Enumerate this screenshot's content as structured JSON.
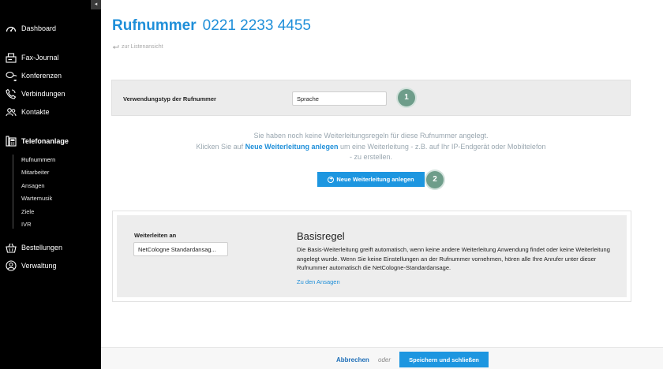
{
  "sidebar": {
    "collapse_glyph": "◂",
    "items": [
      {
        "label": "Dashboard",
        "icon": "dashboard-gauge-icon"
      },
      {
        "label": "Fax-Journal",
        "icon": "fax-icon"
      },
      {
        "label": "Konferenzen",
        "icon": "conference-chat-icon"
      },
      {
        "label": "Verbindungen",
        "icon": "phone-call-icon"
      },
      {
        "label": "Kontakte",
        "icon": "contacts-icon"
      },
      {
        "label": "Telefonanlage",
        "icon": "phone-system-icon"
      },
      {
        "label": "Bestellungen",
        "icon": "shopping-basket-icon"
      },
      {
        "label": "Verwaltung",
        "icon": "user-circle-icon"
      }
    ],
    "sub_items": [
      "Rufnummern",
      "Mitarbeiter",
      "Ansagen",
      "Wartemusik",
      "Ziele",
      "IVR"
    ]
  },
  "header": {
    "title_word": "Rufnummer",
    "title_number": "0221 2233 4455",
    "back_link": "zur Listenansicht"
  },
  "type_panel": {
    "label": "Verwendungstyp der Rufnummer",
    "selected": "Sprache",
    "step": "1"
  },
  "info": {
    "line1": "Sie haben noch keine Weiterleitungsregeln für diese Rufnummer angelegt.",
    "line2_pre": "Klicken Sie auf",
    "line2_link": "Neue Weiterleitung anlegen",
    "line2_post": "um eine Weiterleitung - z.B. auf Ihr IP-Endgerät oder Mobiltelefon",
    "line3": "- zu erstellen."
  },
  "new_button": {
    "label": "Neue Weiterleitung anlegen",
    "step": "2"
  },
  "rule": {
    "fwd_label": "Weiterleiten an",
    "fwd_selected": "NetCologne Standardansag...",
    "title": "Basisregel",
    "description": "Die Basis-Weiterleitung greift automatisch, wenn keine andere Weiterleitung Anwendung findet oder keine Weiterleitung angelegt wurde. Wenn Sie keine Einstellungen an der Rufnummer vornehmen, hören alle Ihre Anrufer unter dieser Rufnummer automatisch die NetCologne-Standardansage.",
    "link": "Zu den Ansagen"
  },
  "footer": {
    "cancel": "Abbrechen",
    "or": "oder",
    "save": "Speichern und schließen"
  },
  "colors": {
    "accent": "#1f8fd9",
    "button": "#1d96e0",
    "badge": "#6e9d8a",
    "sidebar": "#000000"
  }
}
